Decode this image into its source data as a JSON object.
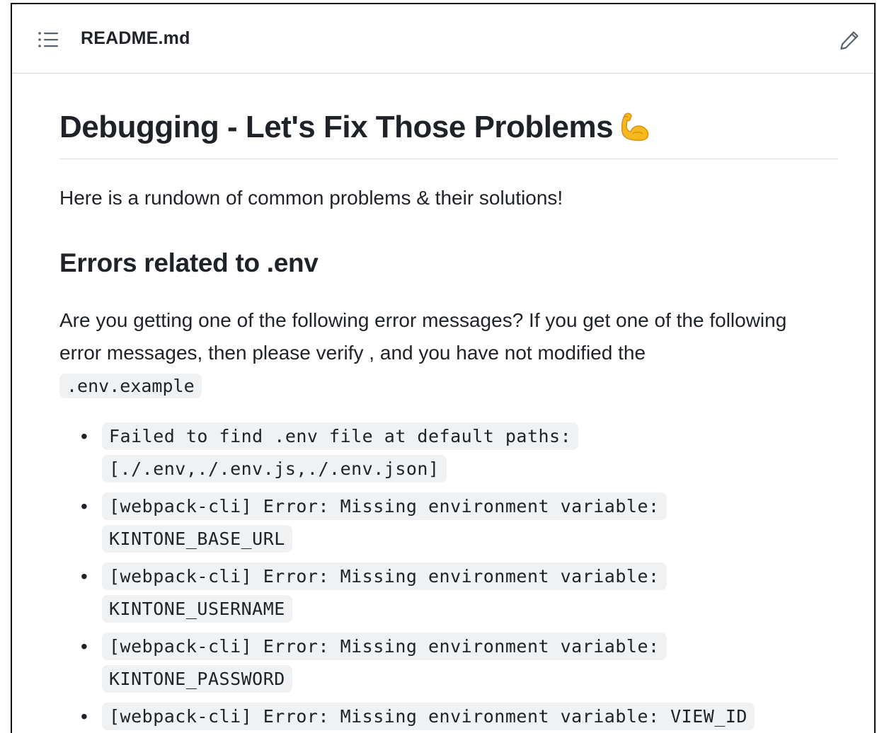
{
  "file_header": {
    "file_name": "README.md",
    "toc_icon": "list-unordered-icon",
    "edit_icon": "pencil-icon"
  },
  "readme": {
    "title": "Debugging - Let's Fix Those Problems",
    "title_emoji": "flexed-biceps-emoji",
    "intro": "Here is a rundown of common problems & their solutions!",
    "section_heading": "Errors related to .env",
    "description": "Are you getting one of the following error messages? If you get one of the following error messages, then please verify , and you have not modified the",
    "description_code": ".env.example",
    "errors": [
      "Failed to find .env file at default paths: [./.env,./.env.js,./.env.json]",
      "[webpack-cli] Error: Missing environment variable: KINTONE_BASE_URL",
      "[webpack-cli] Error: Missing environment variable: KINTONE_USERNAME",
      "[webpack-cli] Error: Missing environment variable: KINTONE_PASSWORD",
      "[webpack-cli] Error: Missing environment variable: VIEW_ID"
    ]
  },
  "colors": {
    "text": "#1f2328",
    "border": "#d0d7de",
    "code_bg": "#eff1f3",
    "emoji": "#f5b91e"
  }
}
